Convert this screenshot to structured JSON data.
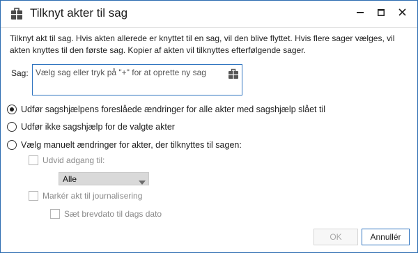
{
  "window": {
    "title": "Tilknyt akter til sag",
    "minimize_icon": "minimize-icon",
    "maximize_icon": "maximize-icon",
    "close_icon": "close-icon",
    "app_icon": "briefcase-icon"
  },
  "description": "Tilknyt akt til sag. Hvis akten allerede er knyttet til en sag, vil den blive flyttet. Hvis flere sager vælges, vil akten knyttes til den første sag. Kopier af akten vil tilknyttes efterfølgende sager.",
  "sag": {
    "label": "Sag:",
    "placeholder": "Vælg sag eller tryk på \"+\" for at oprette ny sag",
    "value": "",
    "icon": "case-picker-icon"
  },
  "options": {
    "radio1": {
      "label": "Udfør sagshjælpens foreslåede ændringer for alle akter med sagshjælp slået til",
      "checked": true
    },
    "radio2": {
      "label": "Udfør ikke sagshjælp for de valgte akter",
      "checked": false
    },
    "radio3": {
      "label": "Vælg manuelt ændringer for akter, der tilknyttes til sagen:",
      "checked": false
    }
  },
  "manual": {
    "udvid_adgang": {
      "label": "Udvid adgang til:",
      "checked": false,
      "enabled": false
    },
    "adgang_select": {
      "selected": "Alle"
    },
    "journalisering": {
      "label": "Markér akt til journalisering",
      "checked": false,
      "enabled": false
    },
    "brevdato": {
      "label": "Sæt brevdato til dags dato",
      "checked": false,
      "enabled": false
    }
  },
  "buttons": {
    "ok": "OK",
    "cancel": "Annullér"
  },
  "colors": {
    "accent": "#2f74c0",
    "disabled_text": "#8a8a8a"
  }
}
